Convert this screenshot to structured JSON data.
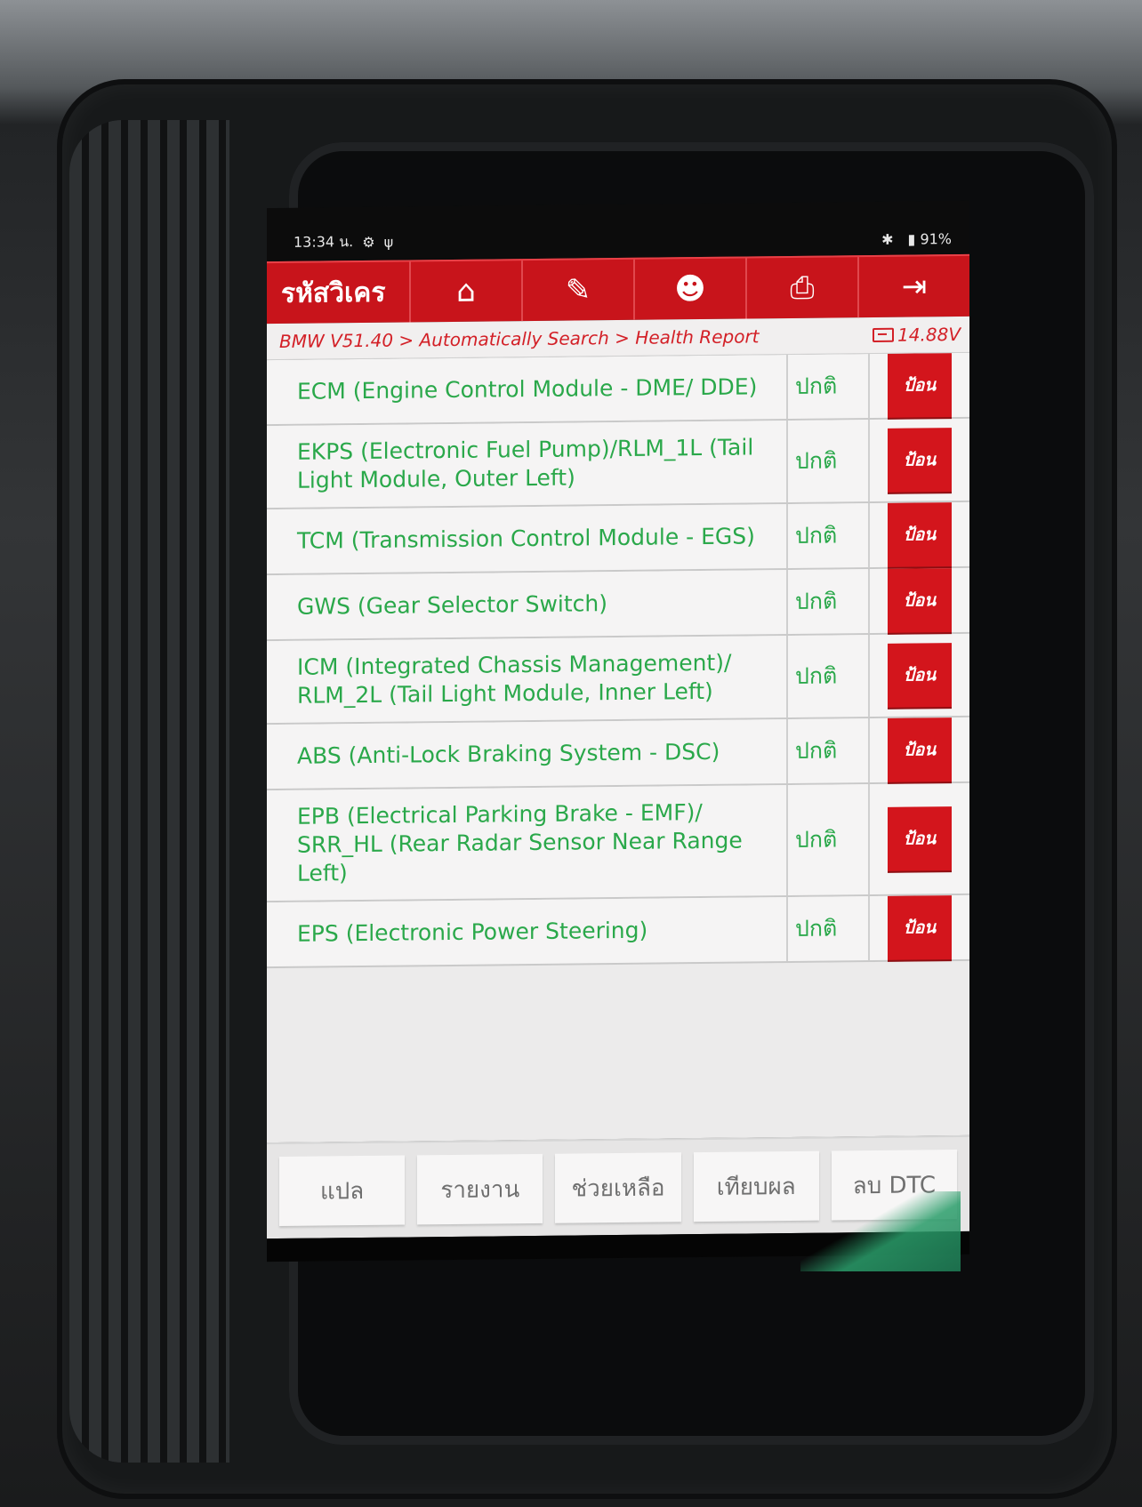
{
  "status_bar": {
    "time": "13:34 น.",
    "battery": "91%"
  },
  "toolbar": {
    "brand": "รหัสวิเคร",
    "buttons": [
      {
        "icon": "home-icon"
      },
      {
        "icon": "edit-icon"
      },
      {
        "icon": "user-icon"
      },
      {
        "icon": "print-icon"
      },
      {
        "icon": "exit-icon"
      }
    ]
  },
  "breadcrumb": {
    "path": "BMW V51.40 > Automatically Search > Health Report",
    "voltage": "14.88V"
  },
  "modules": [
    {
      "name": "ECM (Engine Control Module - DME/ DDE)",
      "status": "ปกติ",
      "action": "ป้อน"
    },
    {
      "name": "EKPS (Electronic Fuel Pump)/RLM_1L (Tail Light Module, Outer Left)",
      "status": "ปกติ",
      "action": "ป้อน"
    },
    {
      "name": "TCM (Transmission Control Module - EGS)",
      "status": "ปกติ",
      "action": "ป้อน"
    },
    {
      "name": "GWS (Gear Selector Switch)",
      "status": "ปกติ",
      "action": "ป้อน"
    },
    {
      "name": "ICM (Integrated Chassis Management)/ RLM_2L (Tail Light Module, Inner Left)",
      "status": "ปกติ",
      "action": "ป้อน"
    },
    {
      "name": "ABS (Anti-Lock Braking System - DSC)",
      "status": "ปกติ",
      "action": "ป้อน"
    },
    {
      "name": "EPB (Electrical Parking Brake - EMF)/ SRR_HL (Rear Radar Sensor Near Range Left)",
      "status": "ปกติ",
      "action": "ป้อน"
    },
    {
      "name": "EPS (Electronic Power Steering)",
      "status": "ปกติ",
      "action": "ป้อน"
    }
  ],
  "bottom_buttons": [
    "แปล",
    "รายงาน",
    "ช่วยเหลือ",
    "เทียบผล",
    "ลบ DTC"
  ],
  "colors": {
    "accent_red": "#c8141b",
    "status_green": "#2aa84a"
  }
}
